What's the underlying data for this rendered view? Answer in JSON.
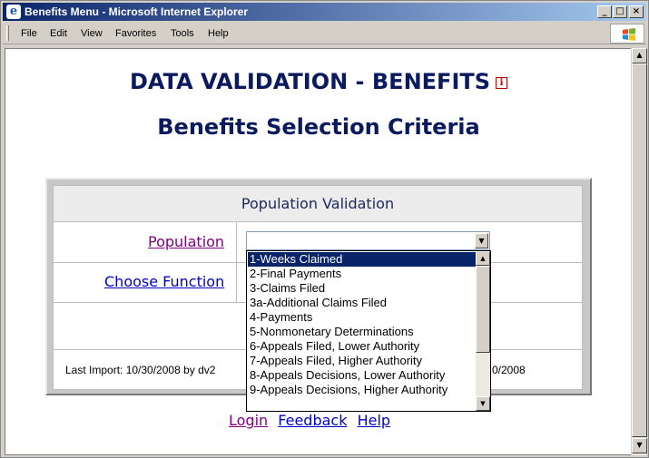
{
  "window": {
    "title": "Benefits Menu - Microsoft Internet Explorer",
    "minimize": "_",
    "maximize": "□",
    "close": "×"
  },
  "menu": {
    "items": [
      "File",
      "Edit",
      "View",
      "Favorites",
      "Tools",
      "Help"
    ]
  },
  "page": {
    "heading": "DATA VALIDATION - BENEFITS",
    "info_icon": "i",
    "subheading": "Benefits Selection Criteria"
  },
  "panel": {
    "header": "Population Validation",
    "population_label": "Population",
    "choose_function_label": "Choose Function",
    "population_value": "",
    "last_import": "Last Import: 10/30/2008 by dv2",
    "footer_right": "0/2008"
  },
  "dropdown": {
    "selected_index": 0,
    "options": [
      "1-Weeks Claimed",
      "2-Final Payments",
      "3-Claims Filed",
      "3a-Additional Claims Filed",
      "4-Payments",
      "5-Nonmonetary Determinations",
      "6-Appeals Filed, Lower Authority",
      "7-Appeals Filed, Higher Authority",
      "8-Appeals Decisions, Lower Authority",
      "9-Appeals Decisions, Higher Authority"
    ]
  },
  "footer_links": {
    "login": "Login",
    "feedback": "Feedback",
    "help": "Help"
  },
  "colors": {
    "heading": "#0b1a5e",
    "visited_link": "#800080",
    "link": "#0000cc",
    "selection": "#0a246a",
    "titlebar": "#0a246a"
  },
  "icons": {
    "app": "ie-icon",
    "info": "info-icon",
    "logo": "windows-flag-icon",
    "dropdown": "chevron-down-icon"
  }
}
